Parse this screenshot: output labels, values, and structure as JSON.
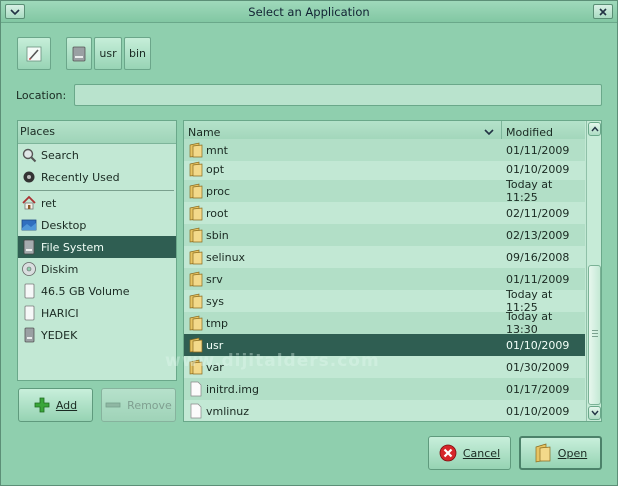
{
  "window": {
    "title": "Select an Application"
  },
  "toolbar": {
    "edit_location_icon": "pencil-icon",
    "path_segments": [
      "usr",
      "bin"
    ]
  },
  "location": {
    "label": "Location:",
    "value": ""
  },
  "places": {
    "header": "Places",
    "items": [
      {
        "label": "Search",
        "icon": "search-icon"
      },
      {
        "label": "Recently Used",
        "icon": "recently-used-icon"
      },
      {
        "label": "ret",
        "icon": "home-icon"
      },
      {
        "label": "Desktop",
        "icon": "desktop-icon"
      },
      {
        "label": "File System",
        "icon": "harddisk-icon",
        "selected": true
      },
      {
        "label": "Diskim",
        "icon": "cdrom-icon"
      },
      {
        "label": "46.5 GB Volume",
        "icon": "volume-icon"
      },
      {
        "label": "HARICI",
        "icon": "volume-icon"
      },
      {
        "label": "YEDEK",
        "icon": "drive-icon"
      }
    ],
    "add_label": "Add",
    "remove_label": "Remove"
  },
  "files": {
    "columns": {
      "name": "Name",
      "modified": "Modified"
    },
    "rows": [
      {
        "name": "mnt",
        "modified": "01/11/2009",
        "type": "folder"
      },
      {
        "name": "opt",
        "modified": "01/10/2009",
        "type": "folder"
      },
      {
        "name": "proc",
        "modified": "Today at 11:25",
        "type": "folder"
      },
      {
        "name": "root",
        "modified": "02/11/2009",
        "type": "folder"
      },
      {
        "name": "sbin",
        "modified": "02/13/2009",
        "type": "folder"
      },
      {
        "name": "selinux",
        "modified": "09/16/2008",
        "type": "folder"
      },
      {
        "name": "srv",
        "modified": "01/11/2009",
        "type": "folder"
      },
      {
        "name": "sys",
        "modified": "Today at 11:25",
        "type": "folder"
      },
      {
        "name": "tmp",
        "modified": "Today at 13:30",
        "type": "folder"
      },
      {
        "name": "usr",
        "modified": "01/10/2009",
        "type": "folder",
        "selected": true
      },
      {
        "name": "var",
        "modified": "01/30/2009",
        "type": "folder"
      },
      {
        "name": "initrd.img",
        "modified": "01/17/2009",
        "type": "file"
      },
      {
        "name": "vmlinuz",
        "modified": "01/10/2009",
        "type": "file"
      }
    ]
  },
  "buttons": {
    "cancel_label": "Cancel",
    "open_label": "Open"
  },
  "watermark": "www.dijitalders.com",
  "colors": {
    "background": "#8fcfae",
    "selection": "#2f5e52",
    "list": "#c2e8d4"
  }
}
